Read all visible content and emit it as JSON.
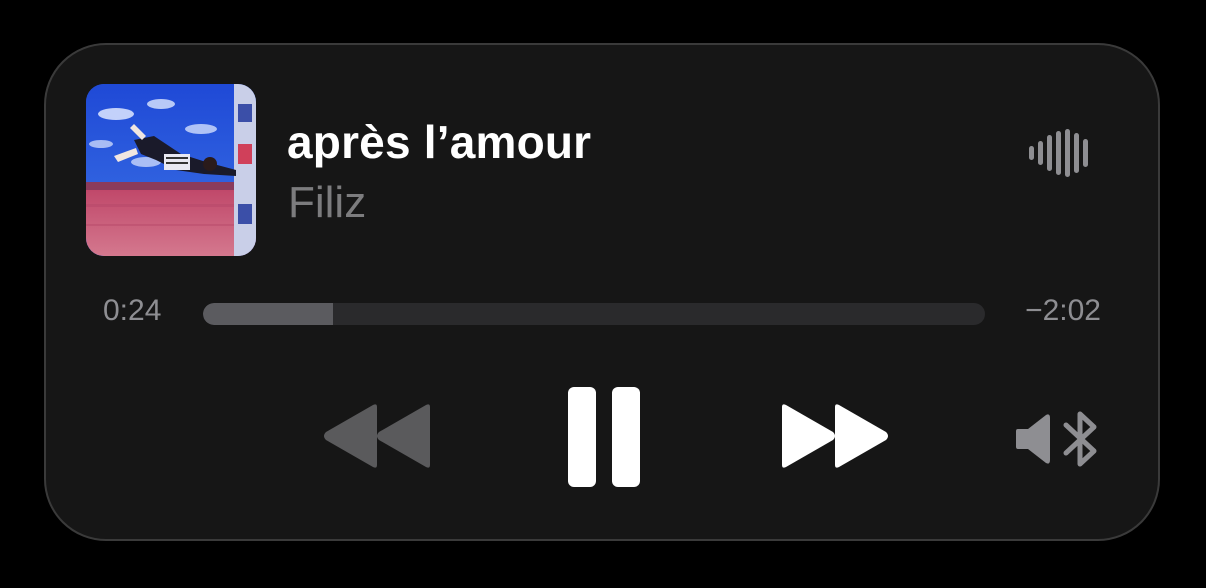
{
  "now_playing": {
    "title": "après l’amour",
    "artist": "Filiz",
    "artwork_icon": "album-artwork",
    "playing_indicator_icon": "waveform-icon"
  },
  "playback": {
    "elapsed": "0:24",
    "remaining": "−2:02",
    "progress_fraction": 0.166
  },
  "controls": {
    "rewind_icon": "rewind-icon",
    "pause_icon": "pause-icon",
    "forward_icon": "fast-forward-icon",
    "output_icon": "bluetooth-speaker-icon"
  },
  "colors": {
    "card_background": "#161616",
    "title_text": "#ffffff",
    "secondary_text": "#7c7c7e",
    "progress_track": "#2a2a2c",
    "progress_fill": "#5b5b5f",
    "rewind_disabled": "#5a5a5c"
  }
}
